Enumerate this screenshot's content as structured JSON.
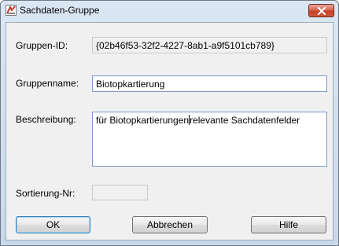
{
  "window": {
    "title": "Sachdaten-Gruppe"
  },
  "form": {
    "gruppen_id_label": "Gruppen-ID:",
    "gruppen_id_value": "{02b46f53-32f2-4227-8ab1-a9f5101cb789}",
    "gruppenname_label": "Gruppenname:",
    "gruppenname_value": "Biotopkartierung",
    "beschreibung_label": "Beschreibung:",
    "beschreibung_before_caret": "für Biotopkartierungen",
    "beschreibung_after_caret": "relevante Sachdatenfelder",
    "sortierung_label": "Sortierung-Nr:",
    "sortierung_value": ""
  },
  "buttons": {
    "ok": "OK",
    "abbrechen": "Abbrechen",
    "hilfe": "Hilfe"
  },
  "colors": {
    "close_button": "#c4402a",
    "input_border": "#7a9ac6",
    "dialog_background": "#f0f0f0"
  }
}
